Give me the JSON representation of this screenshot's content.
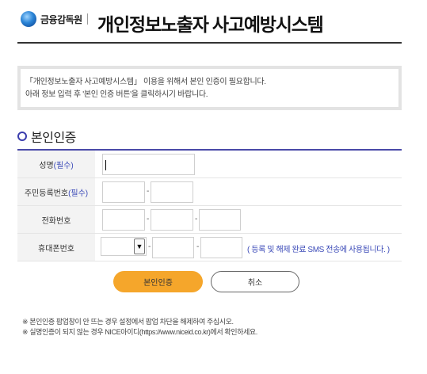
{
  "header": {
    "org_name": "금융감독원",
    "title": "개인정보노출자 사고예방시스템"
  },
  "notice": {
    "line1": "「개인정보노출자 사고예방시스템」 이용을 위해서 본인 인증이 필요합니다.",
    "line2": "아래 정보 입력 후 '본인 인증 버튼'을 클릭하시기 바랍니다."
  },
  "section": {
    "title": "본인인증"
  },
  "form": {
    "name_label": "성명",
    "name_required": "(필수)",
    "rrn_label": "주민등록번호",
    "rrn_required": "(필수)",
    "phone_label": "전화번호",
    "mobile_label": "휴대폰번호",
    "dash": "-",
    "mobile_hint": "( 등록 및 해제 완료 SMS 전송에 사용됩니다. )",
    "name_value": "",
    "rrn_front": "",
    "rrn_back": "",
    "phone_1": "",
    "phone_2": "",
    "phone_3": "",
    "mobile_prefix": "",
    "mobile_2": "",
    "mobile_3": ""
  },
  "buttons": {
    "verify": "본인인증",
    "cancel": "취소"
  },
  "notes": {
    "line1": "※ 본인인증 팝업창이 안 뜨는 경우 설정에서 팝업 차단을 해제하여 주십시오.",
    "line2": "※ 실명인증이 되지 않는 경우 NICE아이디(https://www.niceid.co.kr)에서 확인하세요."
  },
  "colors": {
    "accent": "#3b4ab8",
    "button_primary": "#f5a62b"
  }
}
